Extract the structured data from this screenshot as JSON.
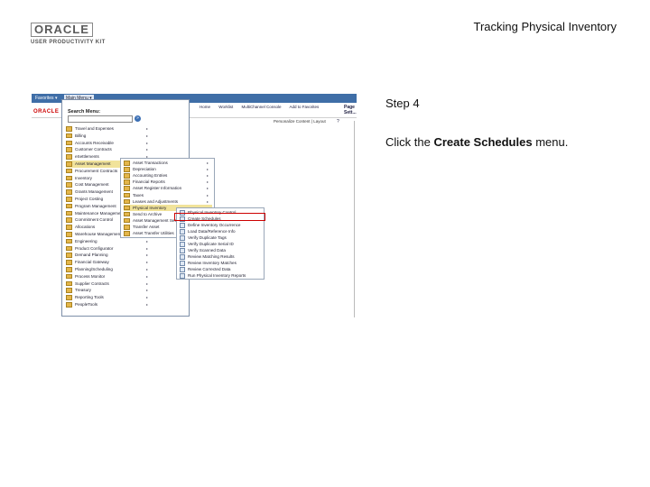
{
  "header": {
    "logo_text": "ORACLE",
    "logo_subtitle": "USER PRODUCTIVITY KIT",
    "doc_title": "Tracking Physical Inventory"
  },
  "screenshot": {
    "topbar": {
      "favorites": "Favorites ▾",
      "main_menu": "Main Menu ▾"
    },
    "banner": {
      "oracle": "ORACLE",
      "links": [
        "Home",
        "Worklist",
        "MultiChannel Console",
        "Add to Favorites"
      ],
      "pagelet": "Page Sett...",
      "personalize": "Personalize Content | Layout",
      "help": "?"
    },
    "search": {
      "label": "Search Menu:",
      "go": "»"
    },
    "main_menu_items": [
      "Travel and Expenses",
      "Billing",
      "Accounts Receivable",
      "Customer Contracts",
      "eSettlements",
      "Asset Management",
      "Procurement Contracts",
      "Inventory",
      "Cost Management",
      "Grants Management",
      "Project Costing",
      "Program Management",
      "Maintenance Management",
      "Commitment Control",
      "Allocations",
      "Warehouse Management",
      "Engineering",
      "Product Configurator",
      "Demand Planning",
      "Financial Gateway",
      "Planning/Scheduling",
      "Process Monitor",
      "Supplier Contracts",
      "Treasury",
      "Reporting Tools",
      "PeopleTools"
    ],
    "asset_submenu": [
      "Asset Transactions",
      "Depreciation",
      "Accounting Entries",
      "Financial Reports",
      "Asset Register Information",
      "Taxes",
      "Leases and Adjustments",
      "Physical Inventory",
      "Send to Archive",
      "Asset Management Setup",
      "Transfer Asset",
      "Asset Transfer Utilities"
    ],
    "physical_inventory_submenu": [
      "Physical Inventory Control",
      "Create Schedules",
      "Define Inventory Occurrence",
      "Load Data/Reference Info",
      "Verify Duplicate Tags",
      "Verify Duplicate Serial ID",
      "Verify Scanned Data",
      "Review Matching Results",
      "Review Inventory Matches",
      "Review Corrected Data",
      "Run Physical Inventory Reports"
    ]
  },
  "instructions": {
    "step": "Step 4",
    "text_before": "Click the ",
    "target": "Create Schedules",
    "text_after": " menu."
  }
}
